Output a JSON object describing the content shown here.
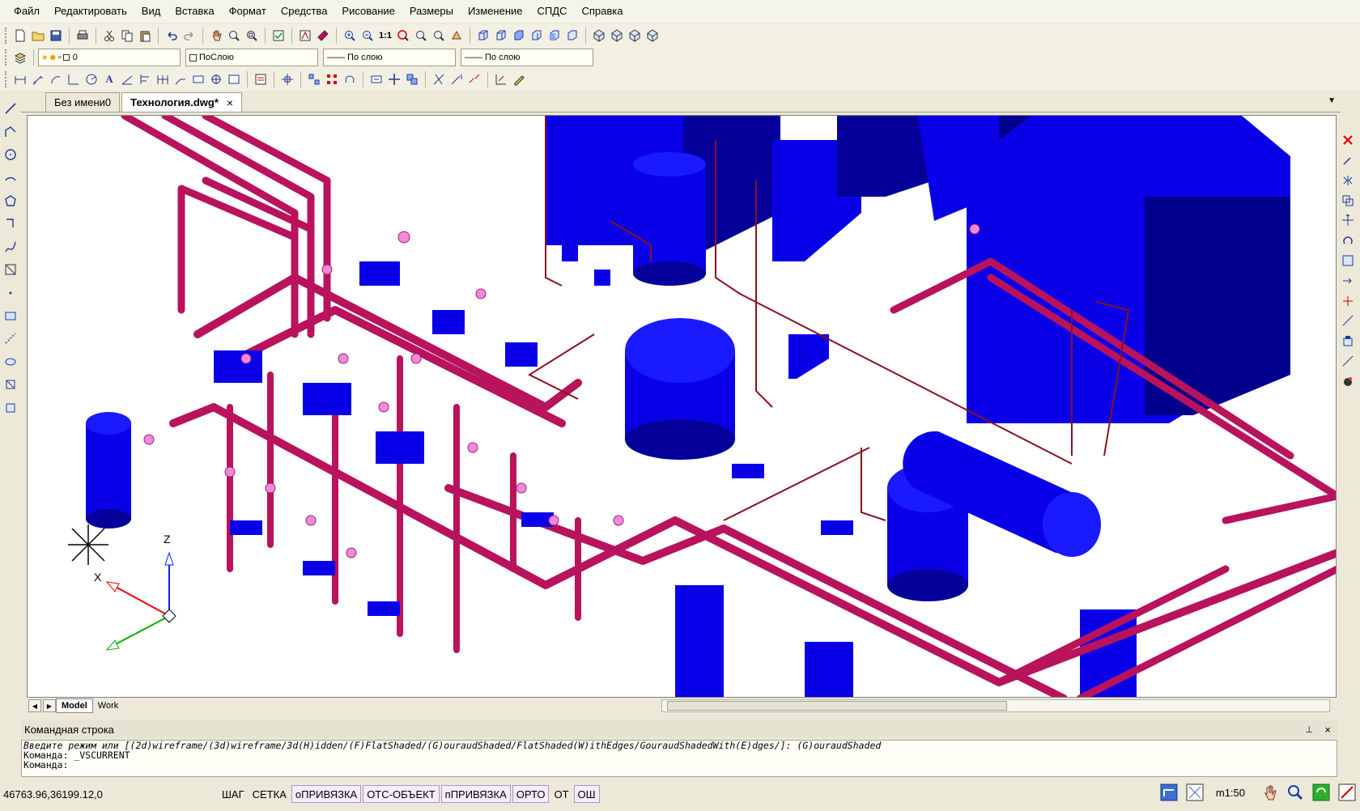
{
  "menu": [
    "Файл",
    "Редактировать",
    "Вид",
    "Вставка",
    "Формат",
    "Средства",
    "Рисование",
    "Размеры",
    "Изменение",
    "СПДС",
    "Справка"
  ],
  "layers": {
    "current_layer": "0",
    "color": "ПоСлою",
    "linetype": "—— По слою",
    "lineweight": "—— По слою"
  },
  "tabs": {
    "doc1": "Без имени0",
    "doc2": "Технология.dwg*",
    "close": "×"
  },
  "layout_tabs": {
    "model": "Model",
    "work": "Work"
  },
  "command": {
    "title": "Командная строка",
    "prompt_line": "Введите режим или [(2d)wireframe/(3d)wireframe/3d(H)idden/(F)FlatShaded/(G)ouraudShaded/FlatShaded(W)ithEdges/GouraudShadedWith(E)dges/]: (G)ouraudShaded",
    "history_line": "Команда: _VSCURRENT",
    "input_label": "Команда:"
  },
  "status": {
    "coords": "46763.96,36199.12,0",
    "buttons": [
      {
        "label": "ШАГ",
        "on": false
      },
      {
        "label": "СЕТКА",
        "on": false
      },
      {
        "label": "оПРИВЯЗКА",
        "on": true
      },
      {
        "label": "ОТС-ОБЪЕКТ",
        "on": true
      },
      {
        "label": "пПРИВЯЗКА",
        "on": true
      },
      {
        "label": "ОРТО",
        "on": true
      },
      {
        "label": "ОТ",
        "on": false
      },
      {
        "label": "ОШ",
        "on": true
      }
    ],
    "scale": "m1:50"
  },
  "ucs": {
    "z": "Z",
    "x": "X"
  },
  "colors": {
    "pipe": "#b8135c",
    "equipment": "#0a00e8",
    "valve": "#f08ad8",
    "line": "#8a1020"
  }
}
